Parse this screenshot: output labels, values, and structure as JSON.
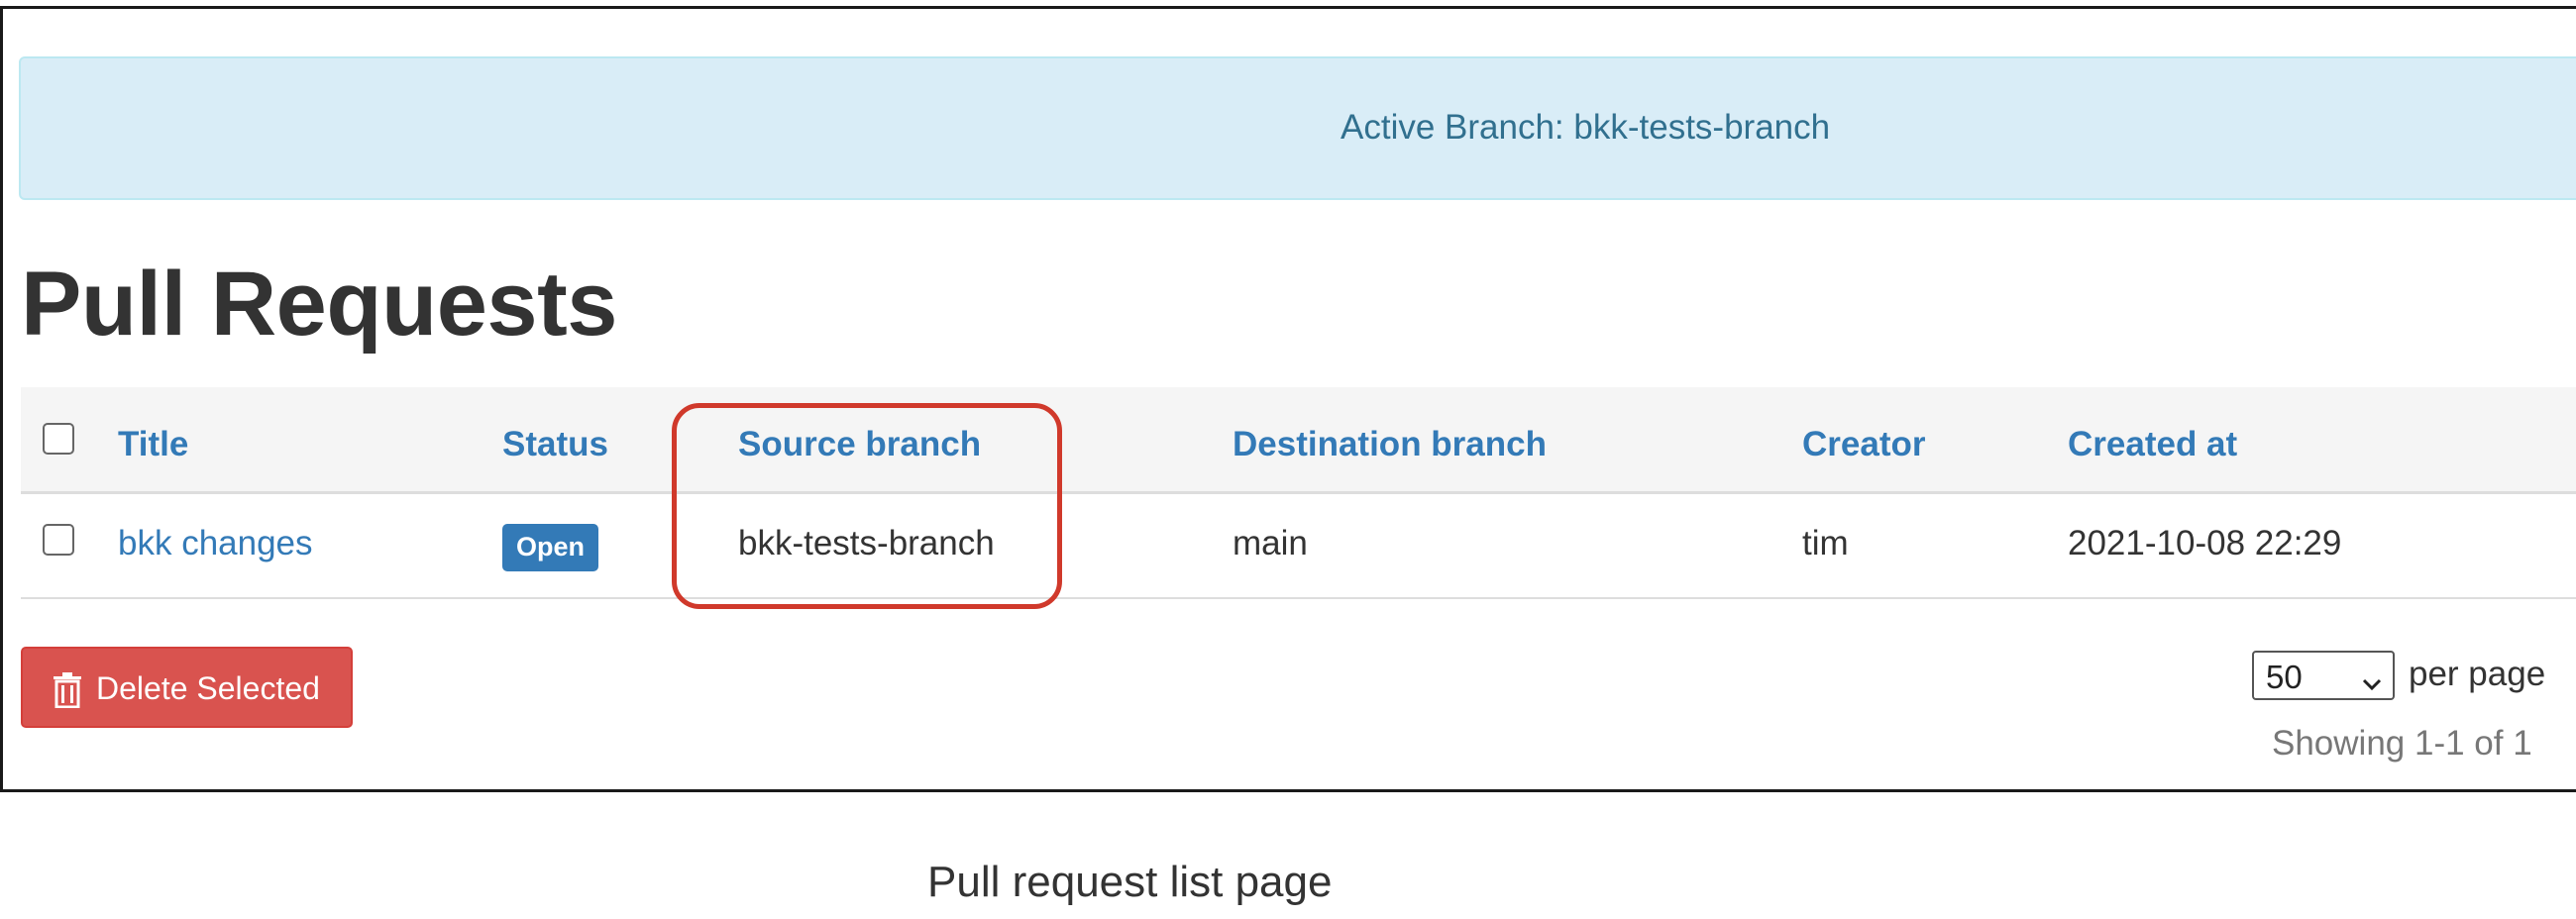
{
  "alert": {
    "text": "Active Branch: bkk-tests-branch"
  },
  "page": {
    "title": "Pull Requests"
  },
  "table": {
    "columns": [
      "Title",
      "Status",
      "Source branch",
      "Destination branch",
      "Creator",
      "Created at"
    ],
    "rows": [
      {
        "title": "bkk changes",
        "status": "Open",
        "source_branch": "bkk-tests-branch",
        "destination_branch": "main",
        "creator": "tim",
        "created_at": "2021-10-08 22:29"
      }
    ]
  },
  "actions": {
    "delete_label": "Delete Selected"
  },
  "pagination": {
    "per_page_value": "50",
    "per_page_label": "per page",
    "showing_text": "Showing 1-1 of 1"
  },
  "caption": "Pull request list page",
  "colors": {
    "link": "#337ab7",
    "alert_bg": "#d9edf7",
    "alert_text": "#31708f",
    "danger": "#d9534f",
    "highlight": "#d0392b",
    "badge": "#337ab7"
  },
  "icons": {
    "delete": "trash-icon",
    "select": "chevron-down-icon"
  }
}
